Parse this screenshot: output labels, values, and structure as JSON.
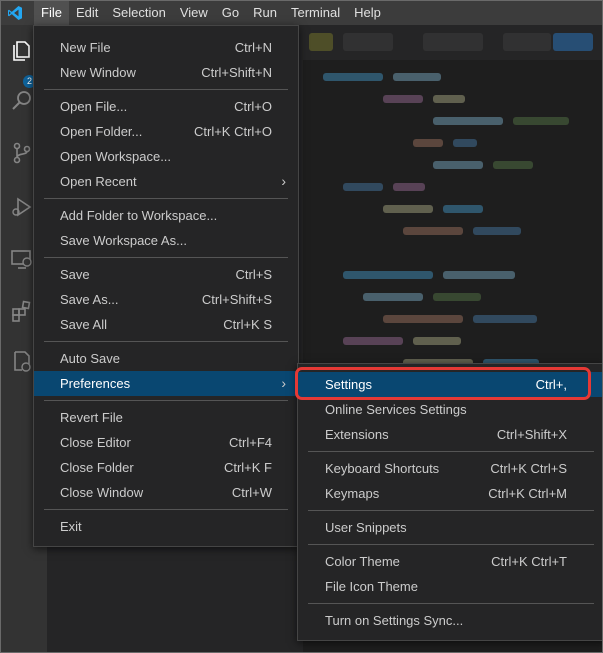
{
  "menubar": {
    "items": [
      "File",
      "Edit",
      "Selection",
      "View",
      "Go",
      "Run",
      "Terminal",
      "Help"
    ],
    "active": "File"
  },
  "activity": {
    "explorer_badge": "2"
  },
  "file_menu": {
    "groups": [
      [
        {
          "label": "New File",
          "shortcut": "Ctrl+N"
        },
        {
          "label": "New Window",
          "shortcut": "Ctrl+Shift+N"
        }
      ],
      [
        {
          "label": "Open File...",
          "shortcut": "Ctrl+O"
        },
        {
          "label": "Open Folder...",
          "shortcut": "Ctrl+K Ctrl+O"
        },
        {
          "label": "Open Workspace...",
          "shortcut": ""
        },
        {
          "label": "Open Recent",
          "shortcut": "",
          "submenu": true
        }
      ],
      [
        {
          "label": "Add Folder to Workspace...",
          "shortcut": ""
        },
        {
          "label": "Save Workspace As...",
          "shortcut": ""
        }
      ],
      [
        {
          "label": "Save",
          "shortcut": "Ctrl+S"
        },
        {
          "label": "Save As...",
          "shortcut": "Ctrl+Shift+S"
        },
        {
          "label": "Save All",
          "shortcut": "Ctrl+K S"
        }
      ],
      [
        {
          "label": "Auto Save",
          "shortcut": ""
        },
        {
          "label": "Preferences",
          "shortcut": "",
          "submenu": true,
          "highlighted": true
        }
      ],
      [
        {
          "label": "Revert File",
          "shortcut": ""
        },
        {
          "label": "Close Editor",
          "shortcut": "Ctrl+F4"
        },
        {
          "label": "Close Folder",
          "shortcut": "Ctrl+K F"
        },
        {
          "label": "Close Window",
          "shortcut": "Ctrl+W"
        }
      ],
      [
        {
          "label": "Exit",
          "shortcut": ""
        }
      ]
    ]
  },
  "preferences_menu": {
    "groups": [
      [
        {
          "label": "Settings",
          "shortcut": "Ctrl+,",
          "highlighted": true
        },
        {
          "label": "Online Services Settings",
          "shortcut": ""
        },
        {
          "label": "Extensions",
          "shortcut": "Ctrl+Shift+X"
        }
      ],
      [
        {
          "label": "Keyboard Shortcuts",
          "shortcut": "Ctrl+K Ctrl+S"
        },
        {
          "label": "Keymaps",
          "shortcut": "Ctrl+K Ctrl+M"
        }
      ],
      [
        {
          "label": "User Snippets",
          "shortcut": ""
        }
      ],
      [
        {
          "label": "Color Theme",
          "shortcut": "Ctrl+K Ctrl+T"
        },
        {
          "label": "File Icon Theme",
          "shortcut": ""
        }
      ],
      [
        {
          "label": "Turn on Settings Sync...",
          "shortcut": ""
        }
      ]
    ]
  },
  "colors": {
    "accent": "#0e639c",
    "highlight": "#094771",
    "callout": "#e53935"
  }
}
